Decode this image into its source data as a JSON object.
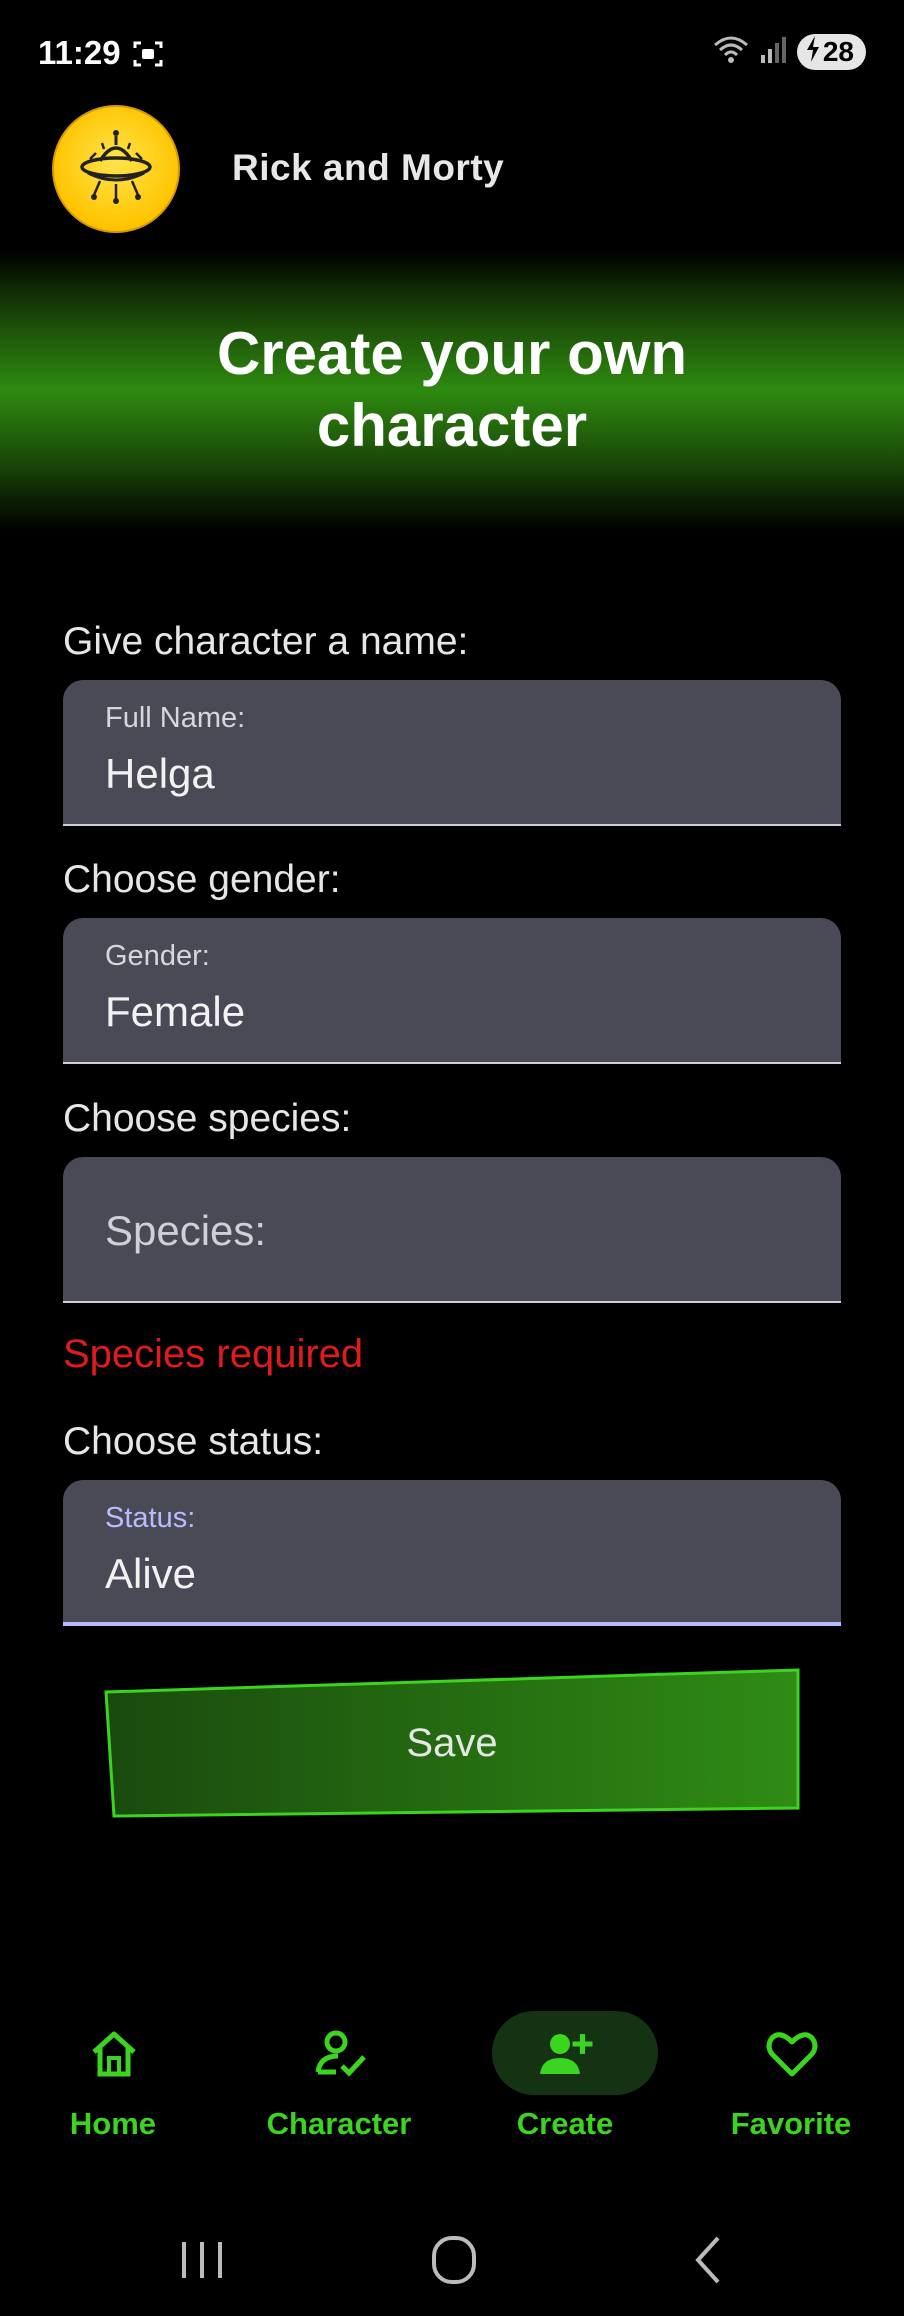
{
  "status_bar": {
    "time": "11:29",
    "battery": "28"
  },
  "header": {
    "app_title": "Rick and Morty",
    "logo_icon": "ufo-icon"
  },
  "banner": {
    "title": "Create your own character"
  },
  "form": {
    "name": {
      "label": "Give character a name:",
      "floating_label": "Full Name:",
      "value": "Helga"
    },
    "gender": {
      "label": "Choose gender:",
      "floating_label": "Gender:",
      "value": "Female"
    },
    "species": {
      "label": "Choose species:",
      "placeholder": "Species:",
      "value": "",
      "error": "Species required"
    },
    "status": {
      "label": "Choose status:",
      "floating_label": "Status:",
      "value": "Alive"
    }
  },
  "save_button": {
    "label": "Save"
  },
  "bottom_nav": {
    "items": [
      {
        "label": "Home",
        "icon": "home-icon"
      },
      {
        "label": "Character",
        "icon": "person-check-icon"
      },
      {
        "label": "Create",
        "icon": "person-add-icon",
        "selected": true
      },
      {
        "label": "Favorite",
        "icon": "heart-icon"
      }
    ]
  },
  "colors": {
    "accent_green": "#3bd41f",
    "error_red": "#e01b1b",
    "field_bg": "#4a4a56",
    "focus_underline": "#b6bcff"
  }
}
